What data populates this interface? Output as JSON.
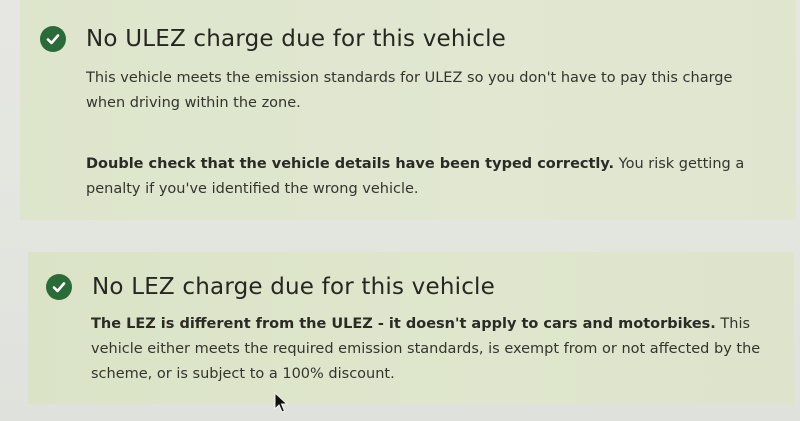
{
  "ulez_panel": {
    "heading": "No ULEZ charge due for this vehicle",
    "paragraph_1": "This vehicle meets the emission standards for ULEZ so you don't have to pay this charge when driving within the zone.",
    "paragraph_2_bold": "Double check that the vehicle details have been typed correctly.",
    "paragraph_2_rest": " You risk getting a penalty if you've identified the wrong vehicle.",
    "icon": "check-circle-icon"
  },
  "lez_panel": {
    "heading": "No LEZ charge due for this vehicle",
    "paragraph_1_bold": "The LEZ is different from the ULEZ - it doesn't apply to cars and motorbikes.",
    "paragraph_1_rest": " This vehicle either meets the required emission standards, is exempt from or not affected by the scheme, or is subject to a 100% discount.",
    "icon": "check-circle-icon"
  },
  "colors": {
    "panel_background": "#dfe6cf",
    "check_icon": "#2b6b3a",
    "text": "#2b2b27"
  }
}
